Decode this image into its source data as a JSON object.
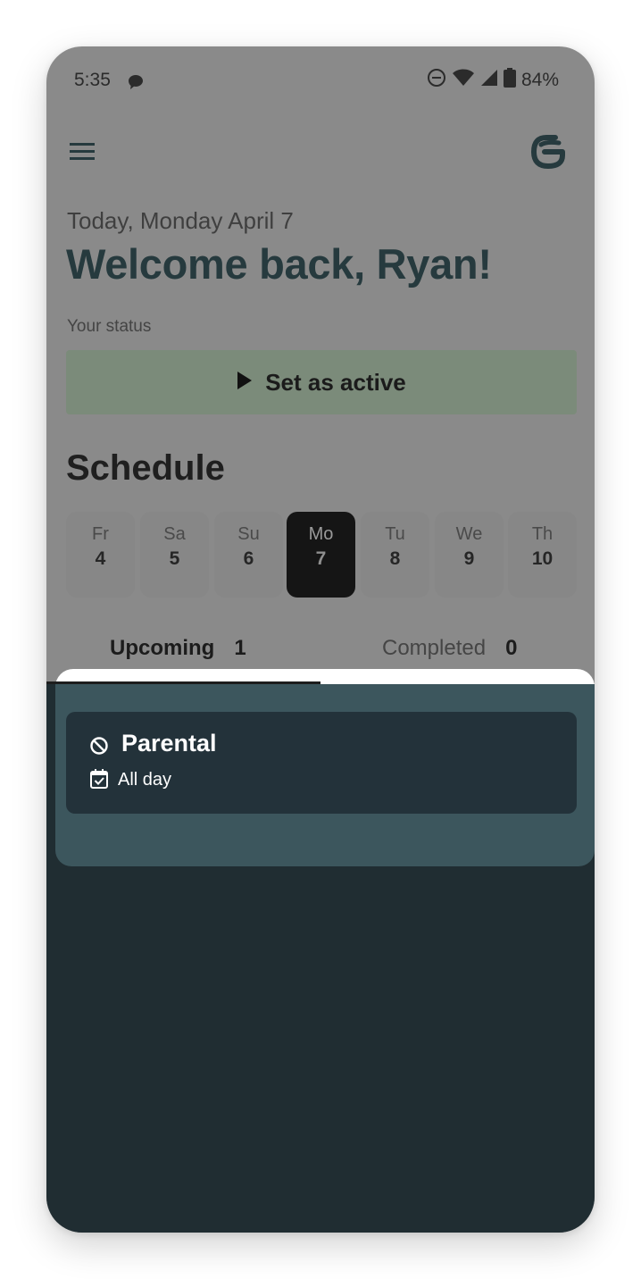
{
  "status_bar": {
    "time": "5:35",
    "battery": "84%"
  },
  "header": {
    "menu_icon": "hamburger-menu-icon",
    "logo_icon": "app-logo-icon"
  },
  "greeting": {
    "date": "Today, Monday April 7",
    "welcome": "Welcome back, Ryan!"
  },
  "status": {
    "label": "Your status",
    "button_label": "Set as active",
    "button_icon": "play-icon",
    "button_color": "#7b8b7a"
  },
  "schedule": {
    "title": "Schedule",
    "days": [
      {
        "name": "Fr",
        "date": "4"
      },
      {
        "name": "Sa",
        "date": "5"
      },
      {
        "name": "Su",
        "date": "6"
      },
      {
        "name": "Mo",
        "date": "7",
        "selected": true
      },
      {
        "name": "Tu",
        "date": "8"
      },
      {
        "name": "We",
        "date": "9"
      },
      {
        "name": "Th",
        "date": "10"
      }
    ]
  },
  "tabs": {
    "upcoming": {
      "label": "Upcoming",
      "count": "1"
    },
    "completed": {
      "label": "Completed",
      "count": "0"
    }
  },
  "events": [
    {
      "title": "Parental",
      "time": "All day",
      "icon": "block-icon",
      "time_icon": "calendar-check-icon"
    }
  ],
  "colors": {
    "overlay": "#8a8a8a",
    "selected_day": "#151515",
    "sheet_dark": "#202d32",
    "sheet_panel": "#3c565d",
    "event_card": "#23323a",
    "heading": "#263a3e"
  }
}
